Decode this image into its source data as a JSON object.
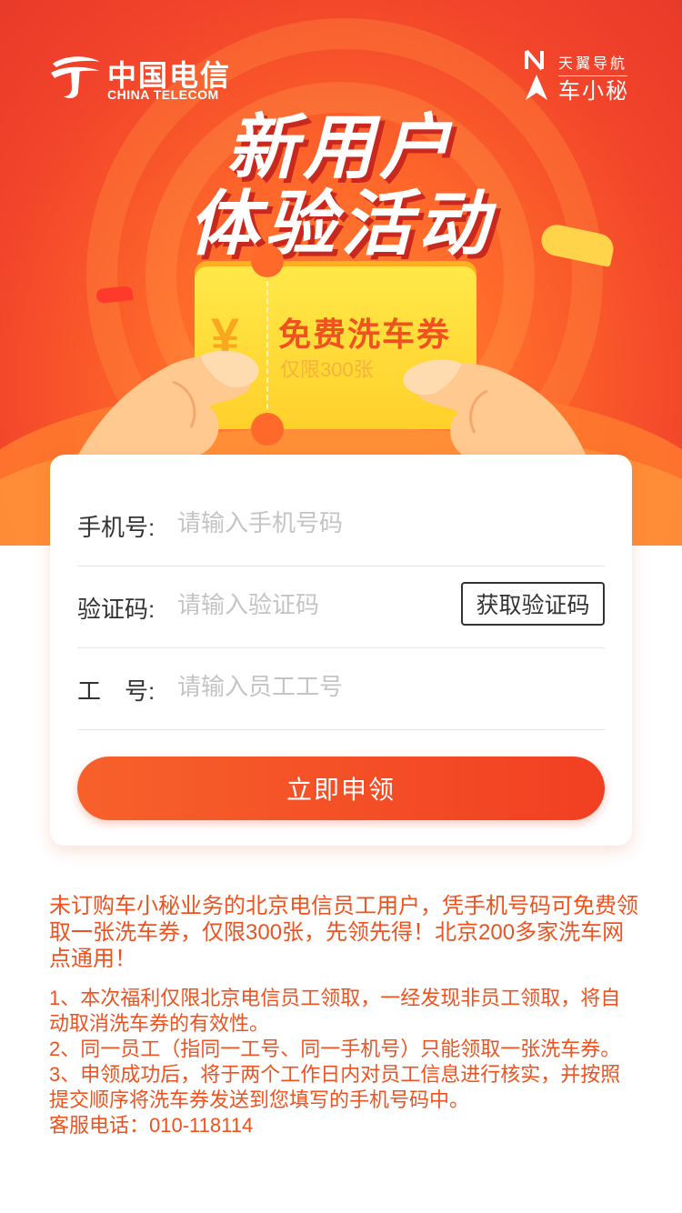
{
  "header": {
    "logo_cn": "中国电信",
    "logo_en": "CHINA TELECOM",
    "brand_top": "天翼导航",
    "brand_bottom": "车小秘"
  },
  "hero": {
    "title_line1": "新用户",
    "title_line2": "体验活动",
    "ticket_symbol": "¥",
    "ticket_title": "免费洗车券",
    "ticket_sub": "仅限300张"
  },
  "form": {
    "phone_label": "手机号:",
    "phone_placeholder": "请输入手机号码",
    "code_label": "验证码:",
    "code_placeholder": "请输入验证码",
    "code_button": "获取验证码",
    "id_label": "工　号:",
    "id_placeholder": "请输入员工工号",
    "submit": "立即申领"
  },
  "info": {
    "intro": "未订购车小秘业务的北京电信员工用户，凭手机号码可免费领取一张洗车券，仅限300张，先领先得！北京200多家洗车网点通用！",
    "rules": [
      "1、本次福利仅限北京电信员工领取，一经发现非员工领取，将自动取消洗车券的有效性。",
      "2、同一员工（指同一工号、同一手机号）只能领取一张洗车券。",
      "3、申领成功后，将于两个工作日内对员工信息进行核实，并按照提交顺序将洗车券发送到您填写的手机号码中。",
      "客服电话：010-118114"
    ]
  },
  "colors": {
    "accent": "#f0521f",
    "hero_red": "#e83a28",
    "ticket_yellow": "#ffe94a"
  },
  "icons": {
    "logo": "china-telecom-logo-icon",
    "brand": "north-arrow-icon"
  }
}
